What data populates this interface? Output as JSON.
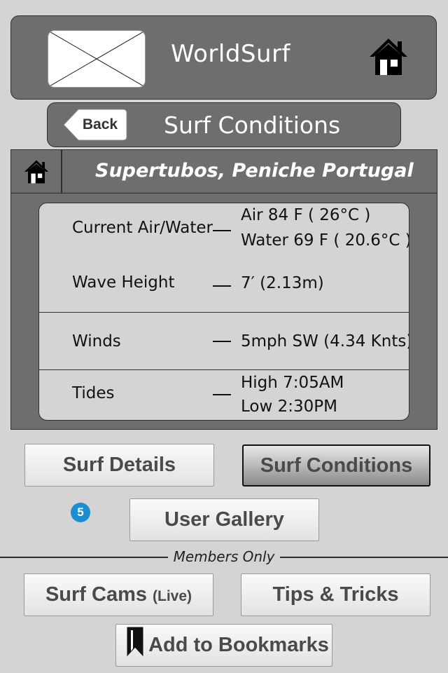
{
  "header": {
    "app_title": "WorldSurf",
    "logo_icon": "image-placeholder-icon",
    "home_icon": "home-icon"
  },
  "subheader": {
    "back_label": "Back",
    "title": "Surf Conditions"
  },
  "location": {
    "name": "Supertubos, Peniche Portugal",
    "home_icon": "home-icon"
  },
  "conditions": {
    "air_water_label": "Current Air/Water",
    "air_value": "Air   84 F  ( 26°C )",
    "water_value": "Water 69 F ( 20.6°C )",
    "wave_label": "Wave Height",
    "wave_value": "7′  (2.13m)",
    "winds_label": "Winds",
    "winds_value": "5mph SW  (4.34 Knts)",
    "tides_label": "Tides",
    "tide_high": "High 7:05AM",
    "tide_low": "Low 2:30PM"
  },
  "buttons": {
    "surf_details": "Surf Details",
    "surf_conditions": "Surf Conditions",
    "user_gallery": "User Gallery",
    "gallery_badge": "5",
    "surf_cams": "Surf Cams",
    "surf_cams_note": "(Live)",
    "tips_tricks": "Tips & Tricks",
    "add_bookmarks": "Add to Bookmarks",
    "bookmark_icon": "bookmark-icon"
  },
  "members_only_label": "Members Only",
  "colors": {
    "panel_gray": "#6e6e6e",
    "background": "#d4d4d4",
    "badge_blue": "#1a8fd0"
  }
}
